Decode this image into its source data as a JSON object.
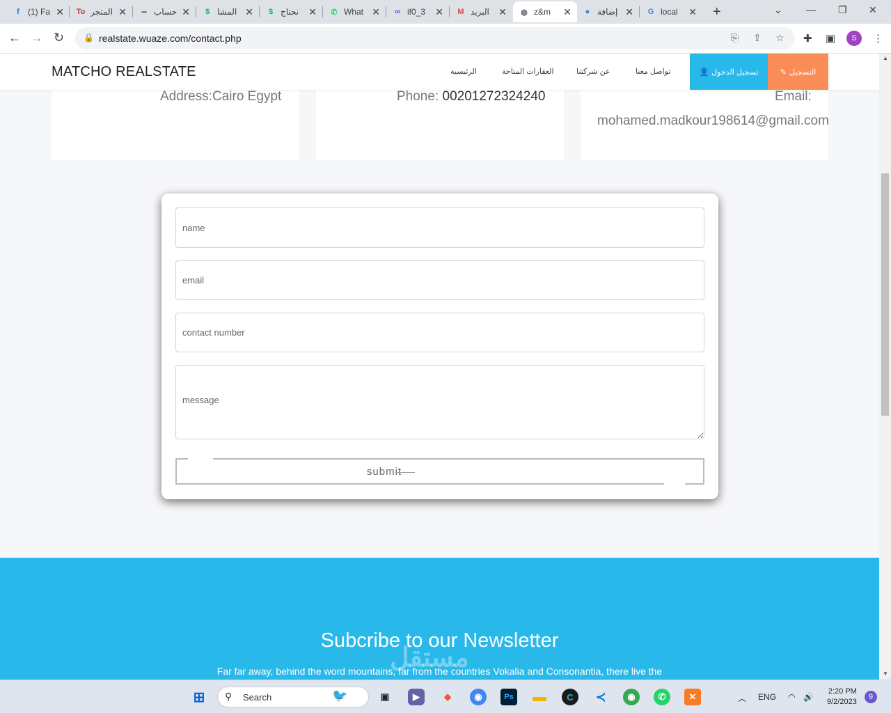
{
  "browser": {
    "tabs": [
      {
        "favicon": "facebook-icon",
        "title": "(1) Fa",
        "fav_char": "f",
        "fav_color": "#1877f2"
      },
      {
        "favicon": "tout-icon",
        "title": "المتجر",
        "fav_char": "To",
        "fav_color": "#d32f2f"
      },
      {
        "favicon": "dash-icon",
        "title": "حساب",
        "fav_char": "━",
        "fav_color": "#43a047"
      },
      {
        "favicon": "dollar-icon",
        "title": "المشا",
        "fav_char": "$",
        "fav_color": "#1db954"
      },
      {
        "favicon": "dollar-icon",
        "title": "نحتاج",
        "fav_char": "$",
        "fav_color": "#1db954"
      },
      {
        "favicon": "whatsapp-icon",
        "title": "What",
        "fav_char": "✆",
        "fav_color": "#25d366"
      },
      {
        "favicon": "infinity-icon",
        "title": "if0_3",
        "fav_char": "∞",
        "fav_color": "#5b3fd6"
      },
      {
        "favicon": "gmail-icon",
        "title": "البريد",
        "fav_char": "M",
        "fav_color": "#ea4335"
      },
      {
        "favicon": "globe-icon",
        "title": "z&m",
        "fav_char": "◍",
        "fav_color": "#5f6368"
      },
      {
        "favicon": "extension-icon",
        "title": "إضافة",
        "fav_char": "●",
        "fav_color": "#1e88e5"
      },
      {
        "favicon": "google-icon",
        "title": "local",
        "fav_char": "G",
        "fav_color": "#4285f4"
      }
    ],
    "url": "realstate.wuaze.com/contact.php",
    "profile_initial": "S",
    "accent": "#a142c4"
  },
  "site": {
    "brand": "MATCHO REALSTATE",
    "nav": {
      "home": "الرئيسية",
      "properties": "العقارات المتاحة",
      "about": "عن شركتنا",
      "contact": "تواصل معنا",
      "login": "تسجيل الدخول",
      "register": "التسجيل"
    },
    "colors": {
      "login": "#29b8ea",
      "register": "#fa8c58",
      "newsletter": "#29b8ea"
    }
  },
  "info": {
    "address": "Address:Cairo Egypt",
    "phone_label": "Phone:",
    "phone_value": "00201272324240",
    "email_label": "Email:",
    "email_value": "mohamed.madkour198614@gmail.com"
  },
  "form": {
    "name_placeholder": "name",
    "email_placeholder": "email",
    "number_placeholder": "contact number",
    "message_placeholder": "message",
    "submit": "submit"
  },
  "newsletter": {
    "title": "Subcribe to our Newsletter",
    "text": "Far far away, behind the word mountains, far from the countries Vokalia and Consonantia, there live the"
  },
  "watermark": "مستقل",
  "taskbar": {
    "search_label": "Search",
    "language": "ENG",
    "time": "2:20 PM",
    "date": "9/2/2023",
    "notifications": "9"
  }
}
